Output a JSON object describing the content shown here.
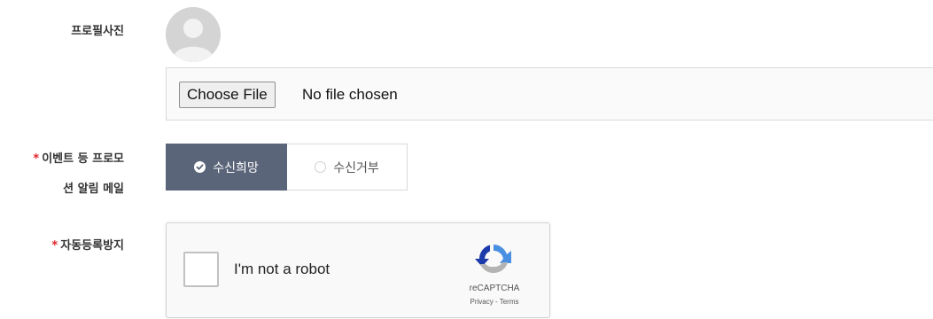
{
  "profile": {
    "label": "프로필사진",
    "file_button": "Choose File",
    "file_status": "No file chosen"
  },
  "event_email": {
    "required_mark": "*",
    "label_line1": "이벤트 등 프로모",
    "label_line2": "션 알림 메일",
    "options": [
      {
        "label": "수신희망",
        "selected": true
      },
      {
        "label": "수신거부",
        "selected": false
      }
    ]
  },
  "antispam": {
    "required_mark": "*",
    "label": "자동등록방지",
    "checkbox_text": "I'm not a robot",
    "brand": "reCAPTCHA",
    "links": "Privacy - Terms"
  },
  "colors": {
    "selected_bg": "#5b6579",
    "required": "#e0242b",
    "recaptcha_blue": "#4a90e2",
    "recaptcha_gray": "#b3b3b3"
  }
}
